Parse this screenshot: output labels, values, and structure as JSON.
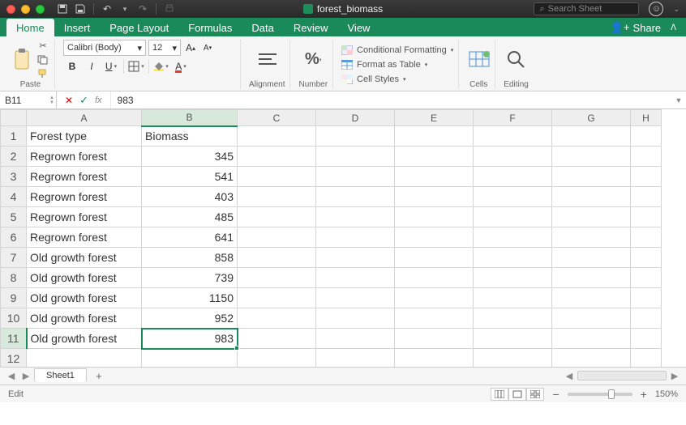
{
  "app": {
    "filename": "forest_biomass",
    "search_placeholder": "Search Sheet"
  },
  "tabs": {
    "items": [
      "Home",
      "Insert",
      "Page Layout",
      "Formulas",
      "Data",
      "Review",
      "View"
    ],
    "active": 0,
    "share": "Share"
  },
  "ribbon": {
    "paste": "Paste",
    "font_name": "Calibri (Body)",
    "font_size": "12",
    "alignment": "Alignment",
    "number": "Number",
    "cond_fmt": "Conditional Formatting",
    "as_table": "Format as Table",
    "cell_styles": "Cell Styles",
    "cells": "Cells",
    "editing": "Editing"
  },
  "formula_bar": {
    "cell_ref": "B11",
    "fx": "fx",
    "value": "983"
  },
  "grid": {
    "columns": [
      "A",
      "B",
      "C",
      "D",
      "E",
      "F",
      "G",
      "H"
    ],
    "selected_cell": {
      "row": 11,
      "col": "B"
    },
    "rows": [
      {
        "n": 1,
        "A": "Forest type",
        "B": "Biomass"
      },
      {
        "n": 2,
        "A": "Regrown forest",
        "B": "345"
      },
      {
        "n": 3,
        "A": "Regrown forest",
        "B": "541"
      },
      {
        "n": 4,
        "A": "Regrown forest",
        "B": "403"
      },
      {
        "n": 5,
        "A": "Regrown forest",
        "B": "485"
      },
      {
        "n": 6,
        "A": "Regrown forest",
        "B": "641"
      },
      {
        "n": 7,
        "A": "Old growth forest",
        "B": "858"
      },
      {
        "n": 8,
        "A": "Old growth forest",
        "B": "739"
      },
      {
        "n": 9,
        "A": "Old growth forest",
        "B": "1150"
      },
      {
        "n": 10,
        "A": "Old growth forest",
        "B": "952"
      },
      {
        "n": 11,
        "A": "Old growth forest",
        "B": "983"
      },
      {
        "n": 12,
        "A": "",
        "B": ""
      }
    ]
  },
  "sheets": {
    "active": "Sheet1"
  },
  "status": {
    "mode": "Edit",
    "zoom": "150%"
  }
}
